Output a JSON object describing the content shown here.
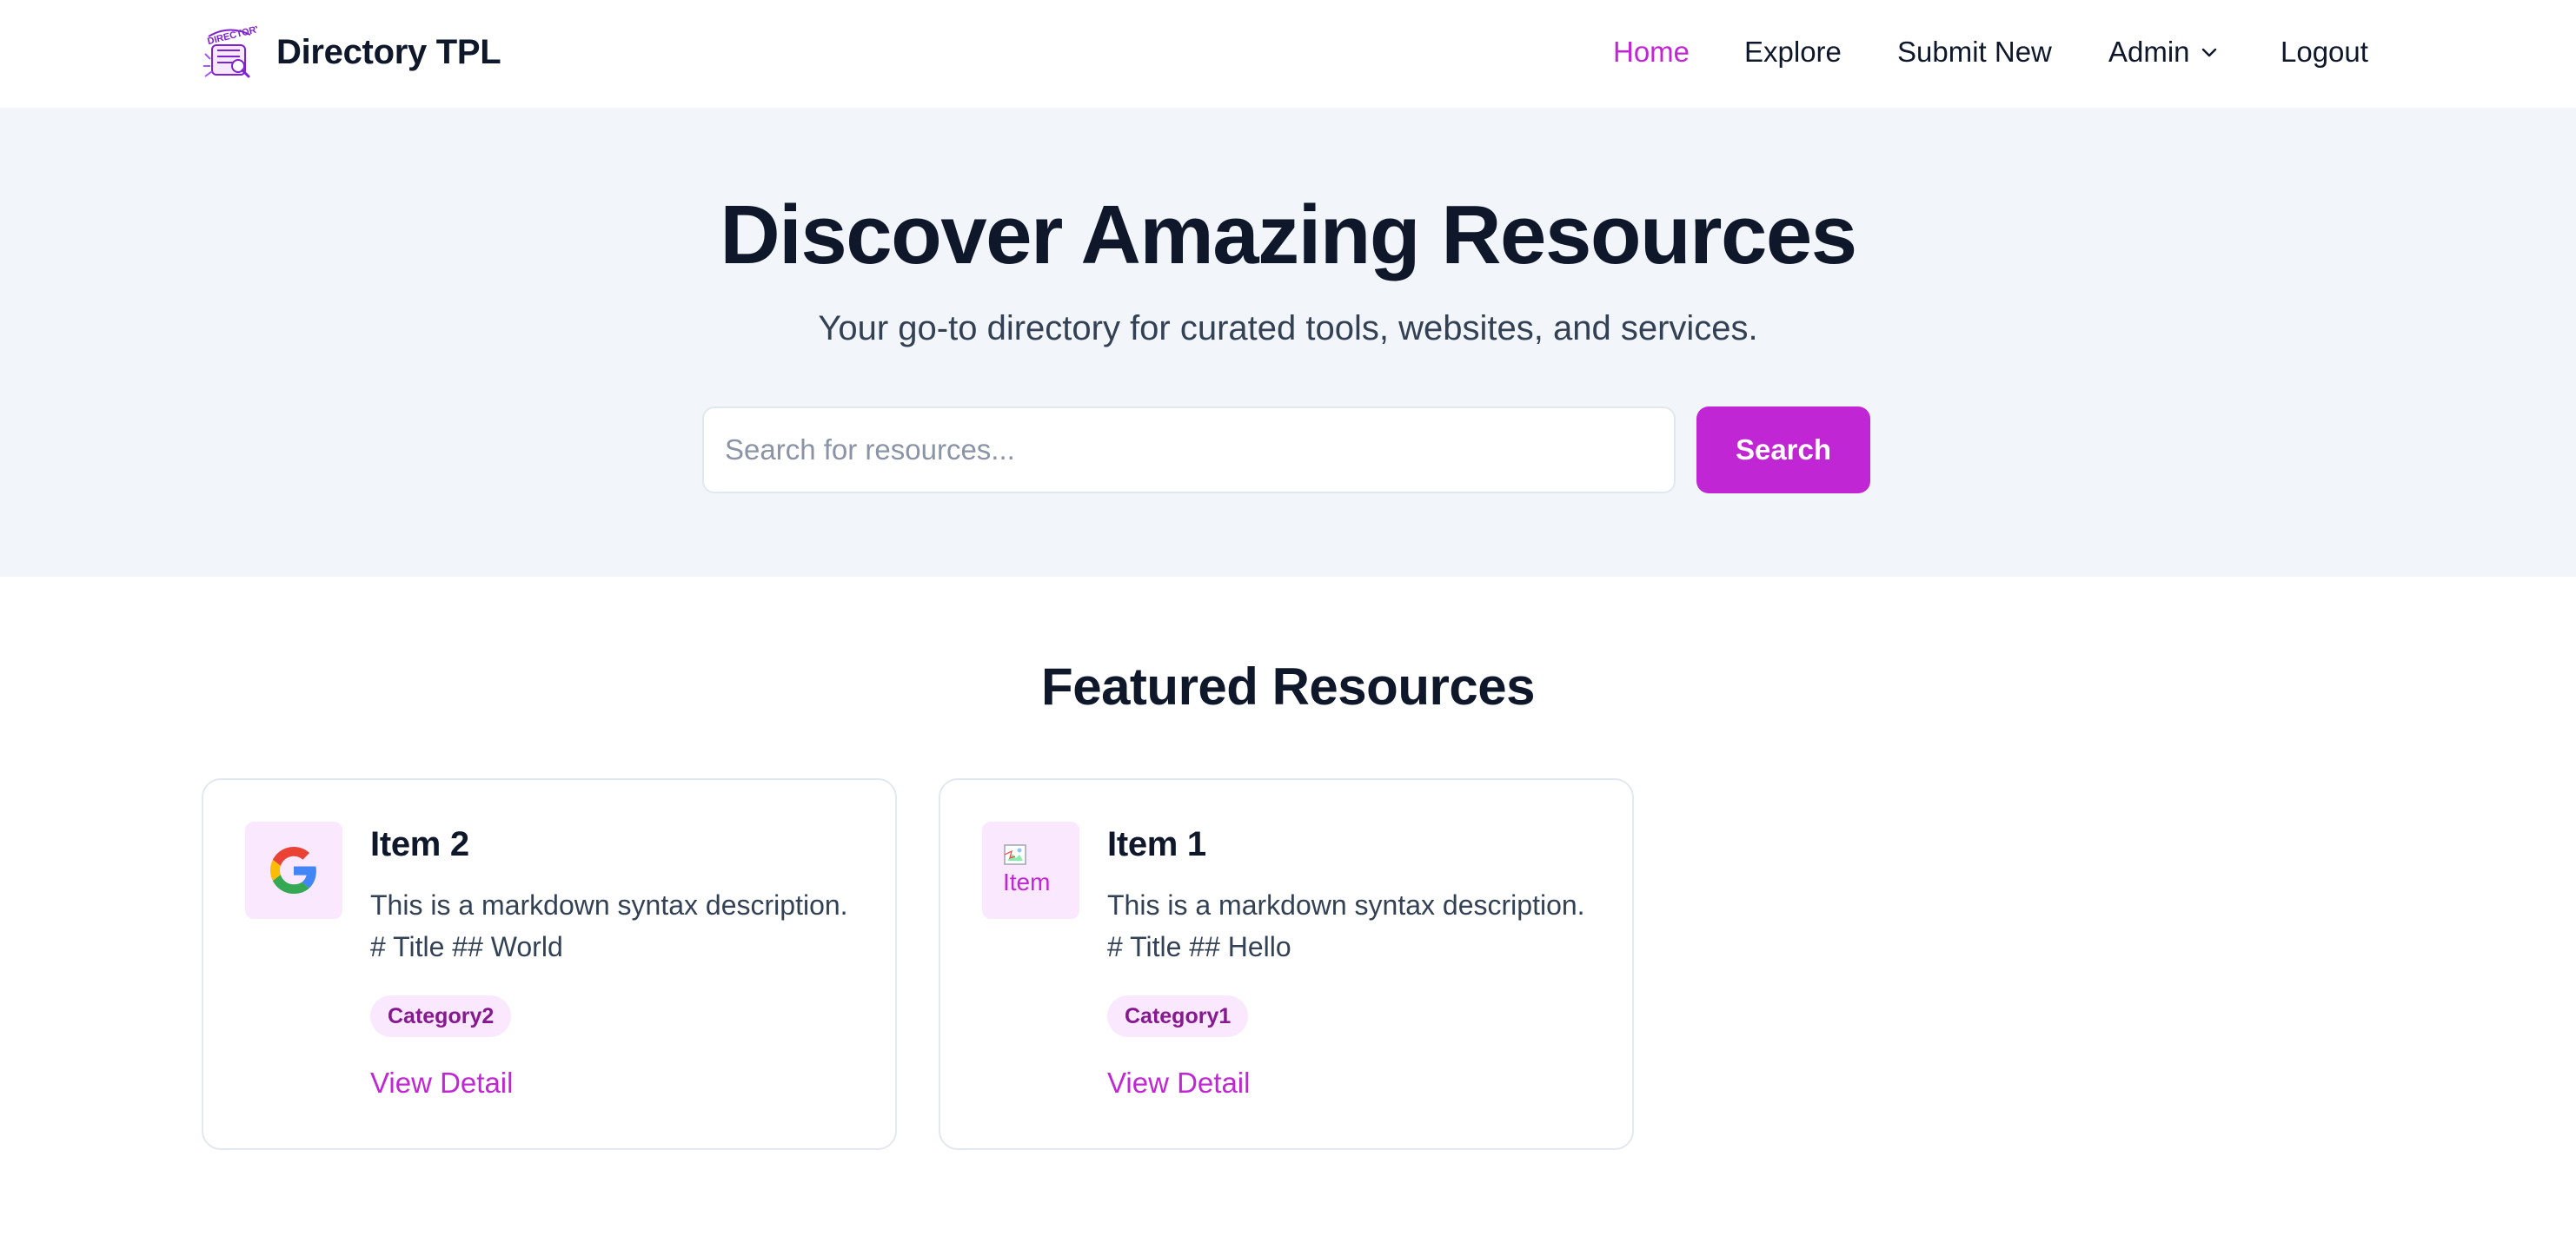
{
  "header": {
    "brand_name": "Directory TPL",
    "logo_text": "DIRECTORY",
    "nav": {
      "home": "Home",
      "explore": "Explore",
      "submit_new": "Submit New",
      "admin": "Admin",
      "logout": "Logout"
    }
  },
  "hero": {
    "title": "Discover Amazing Resources",
    "subtitle": "Your go-to directory for curated tools, websites, and services.",
    "search_placeholder": "Search for resources...",
    "search_button": "Search"
  },
  "featured": {
    "title": "Featured Resources",
    "items": [
      {
        "title": "Item 2",
        "description": "This is a markdown syntax description. # Title ## World",
        "category": "Category2",
        "link": "View Detail",
        "icon": "google-icon"
      },
      {
        "title": "Item 1",
        "description": "This is a markdown syntax description. # Title ## Hello",
        "category": "Category1",
        "link": "View Detail",
        "icon": "broken-image-icon",
        "image_alt": "Item"
      }
    ]
  },
  "colors": {
    "accent": "#c026d3",
    "accent_light": "#fae8ff",
    "badge_text": "#86198f",
    "hero_bg": "#f2f5f9",
    "text_dark": "#0f172a"
  }
}
